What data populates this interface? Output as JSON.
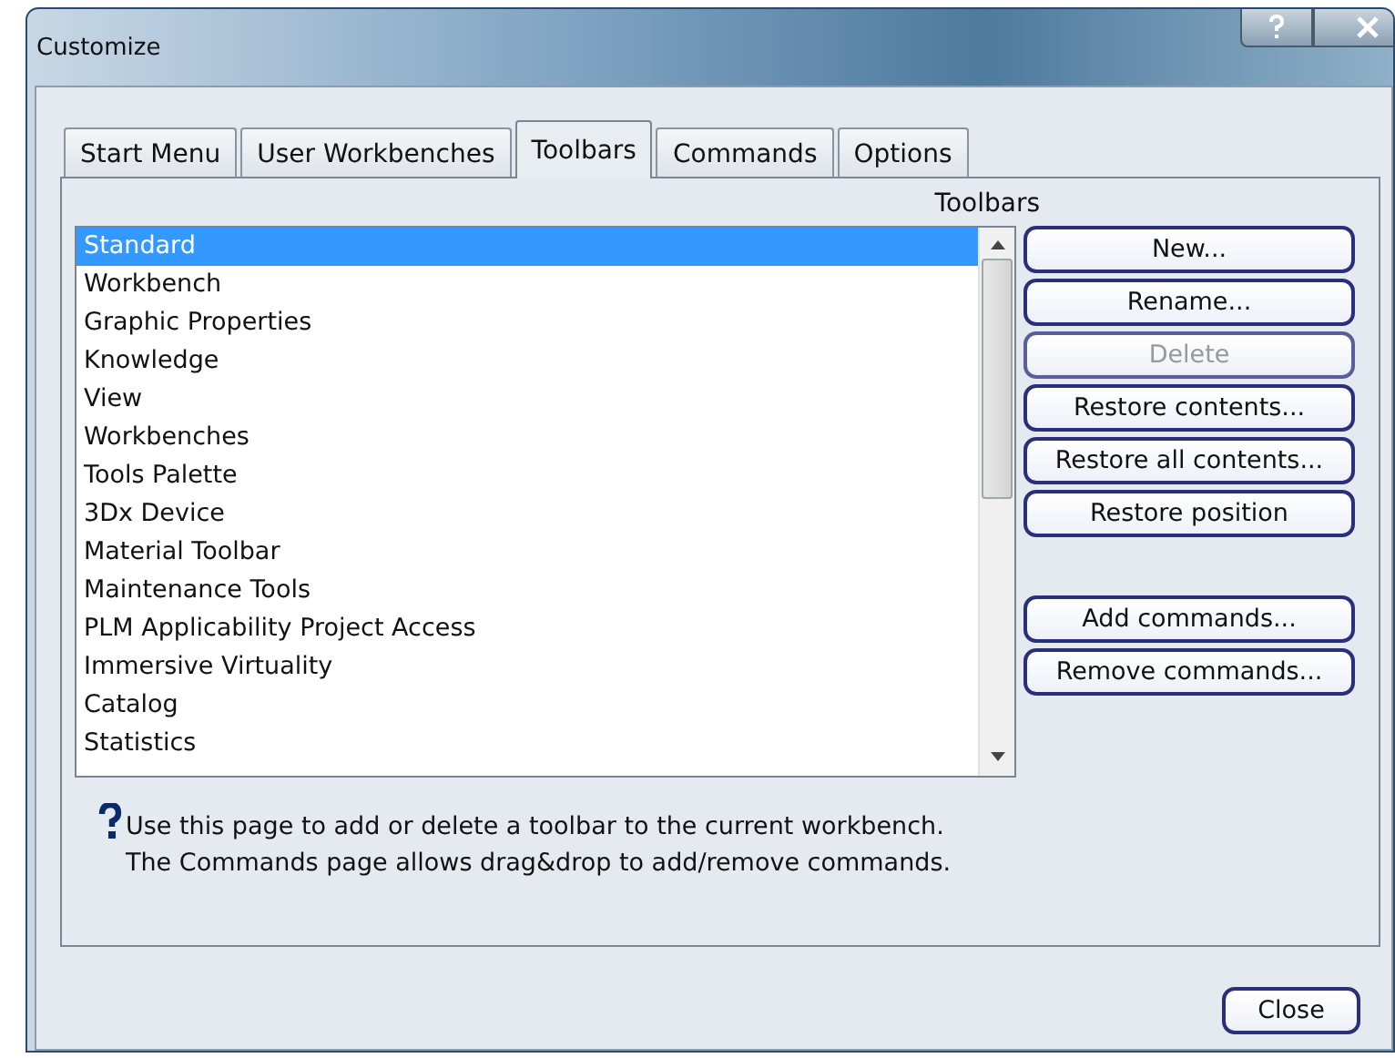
{
  "window": {
    "title": "Customize"
  },
  "tabs": [
    {
      "label": "Start Menu",
      "selected": false
    },
    {
      "label": "User Workbenches",
      "selected": false
    },
    {
      "label": "Toolbars",
      "selected": true
    },
    {
      "label": "Commands",
      "selected": false
    },
    {
      "label": "Options",
      "selected": false
    }
  ],
  "list": {
    "heading": "Toolbars",
    "items": [
      {
        "label": "Standard",
        "selected": true
      },
      {
        "label": "Workbench",
        "selected": false
      },
      {
        "label": "Graphic Properties",
        "selected": false
      },
      {
        "label": "Knowledge",
        "selected": false
      },
      {
        "label": "View",
        "selected": false
      },
      {
        "label": "Workbenches",
        "selected": false
      },
      {
        "label": "Tools Palette",
        "selected": false
      },
      {
        "label": "3Dx Device",
        "selected": false
      },
      {
        "label": "Material Toolbar",
        "selected": false
      },
      {
        "label": "Maintenance Tools",
        "selected": false
      },
      {
        "label": "PLM Applicability Project Access",
        "selected": false
      },
      {
        "label": "Immersive Virtuality",
        "selected": false
      },
      {
        "label": "Catalog",
        "selected": false
      },
      {
        "label": "Statistics",
        "selected": false
      }
    ]
  },
  "buttons": [
    {
      "label": "New...",
      "disabled": false
    },
    {
      "label": "Rename...",
      "disabled": false
    },
    {
      "label": "Delete",
      "disabled": true
    },
    {
      "label": "Restore contents...",
      "disabled": false
    },
    {
      "label": "Restore all contents...",
      "disabled": false
    },
    {
      "label": "Restore position",
      "disabled": false
    }
  ],
  "command_buttons": [
    {
      "label": "Add commands...",
      "disabled": false
    },
    {
      "label": "Remove commands...",
      "disabled": false
    }
  ],
  "help": {
    "lines": [
      "Use this page to add or delete a toolbar to the current workbench.",
      "The Commands page allows drag&drop to add/remove commands."
    ]
  },
  "footer_button": "Close"
}
